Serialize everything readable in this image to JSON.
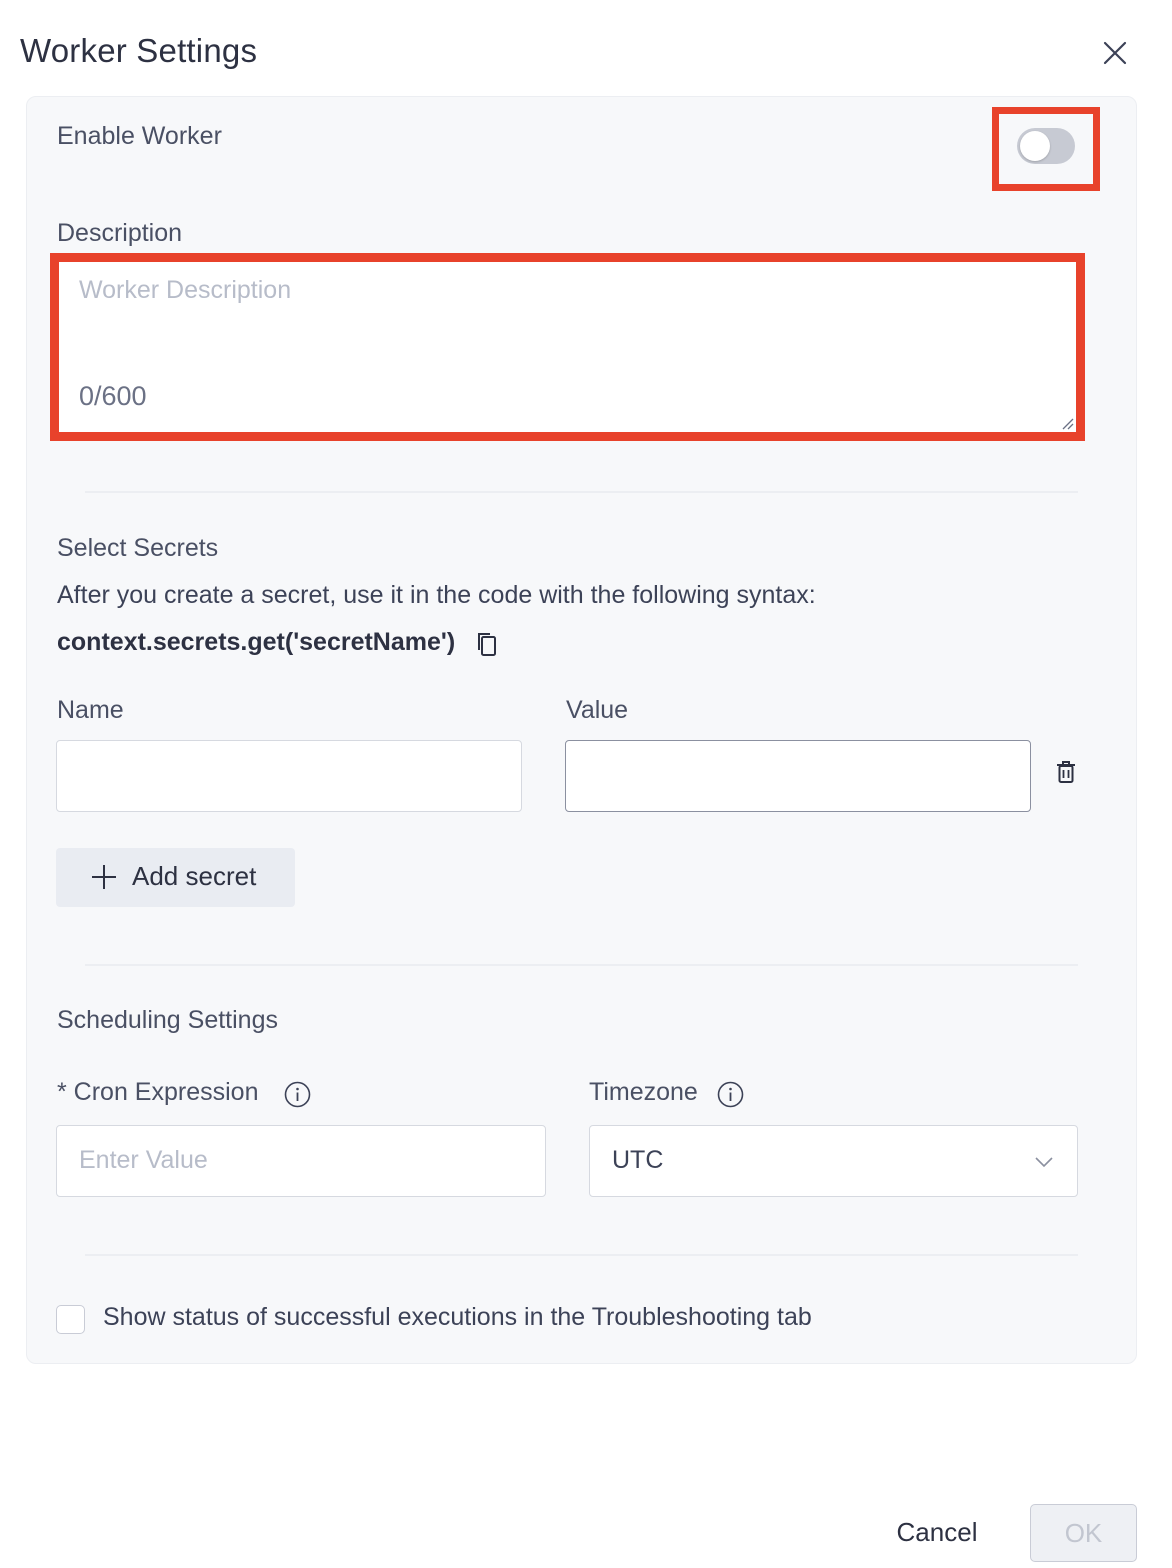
{
  "dialog": {
    "title": "Worker Settings"
  },
  "enable": {
    "label": "Enable Worker",
    "enabled": false
  },
  "description": {
    "label": "Description",
    "placeholder": "Worker Description",
    "counter": "0/600"
  },
  "secrets": {
    "heading": "Select Secrets",
    "help": "After you create a secret, use it in the code with the following syntax:",
    "syntax": "context.secrets.get('secretName')",
    "name_label": "Name",
    "value_label": "Value",
    "name_value": "",
    "value_value": "",
    "add_label": "Add secret"
  },
  "scheduling": {
    "heading": "Scheduling Settings",
    "cron_label": "* Cron Expression",
    "cron_placeholder": "Enter Value",
    "timezone_label": "Timezone",
    "timezone_value": "UTC"
  },
  "show_status": {
    "label": "Show status of successful executions in the Troubleshooting tab",
    "checked": false
  },
  "footer": {
    "cancel": "Cancel",
    "ok": "OK"
  },
  "colors": {
    "highlight": "#e8422b",
    "panel": "#f7f8fa"
  }
}
